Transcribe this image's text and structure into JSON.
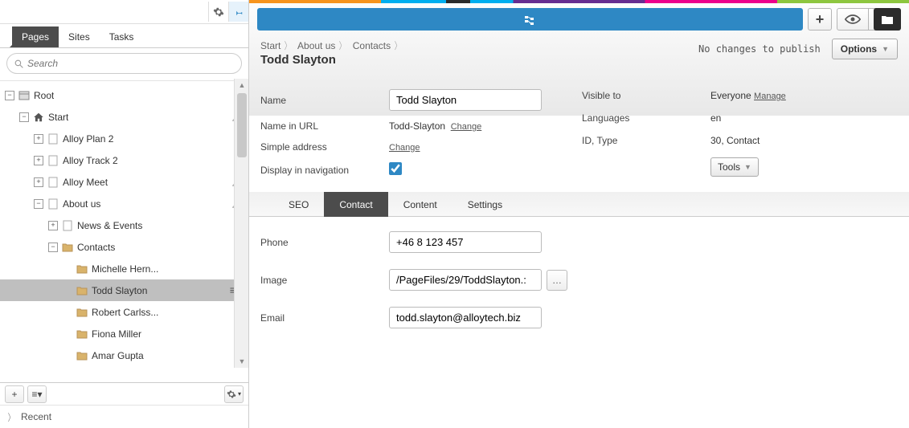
{
  "tabs": {
    "pages": "Pages",
    "sites": "Sites",
    "tasks": "Tasks"
  },
  "search": {
    "placeholder": "Search"
  },
  "tree": {
    "root": "Root",
    "start": "Start",
    "alloy_plan": "Alloy Plan 2",
    "alloy_track": "Alloy Track 2",
    "alloy_meet": "Alloy Meet",
    "about_us": "About us",
    "news_events": "News & Events",
    "contacts": "Contacts",
    "c1": "Michelle Hern...",
    "c2": "Todd Slayton",
    "c3": "Robert Carlss...",
    "c4": "Fiona Miller",
    "c5": "Amar Gupta"
  },
  "recent": "Recent",
  "breadcrumb": {
    "b1": "Start",
    "b2": "About us",
    "b3": "Contacts"
  },
  "page_title": "Todd Slayton",
  "publish_status": "No changes to publish",
  "options_label": "Options",
  "form": {
    "name_label": "Name",
    "name_value": "Todd Slayton",
    "url_label": "Name in URL",
    "url_value": "Todd-Slayton",
    "url_change": "Change",
    "simple_label": "Simple address",
    "simple_change": "Change",
    "nav_label": "Display in navigation",
    "visible_label": "Visible to",
    "visible_value": "Everyone",
    "visible_manage": "Manage",
    "lang_label": "Languages",
    "lang_value": "en",
    "id_label": "ID, Type",
    "id_value": "30, Contact",
    "tools": "Tools"
  },
  "ctabs": {
    "seo": "SEO",
    "contact": "Contact",
    "content": "Content",
    "settings": "Settings"
  },
  "contact": {
    "phone_label": "Phone",
    "phone_value": "+46 8 123 457",
    "image_label": "Image",
    "image_value": "/PageFiles/29/ToddSlayton.:",
    "email_label": "Email",
    "email_value": "todd.slayton@alloytech.biz"
  }
}
